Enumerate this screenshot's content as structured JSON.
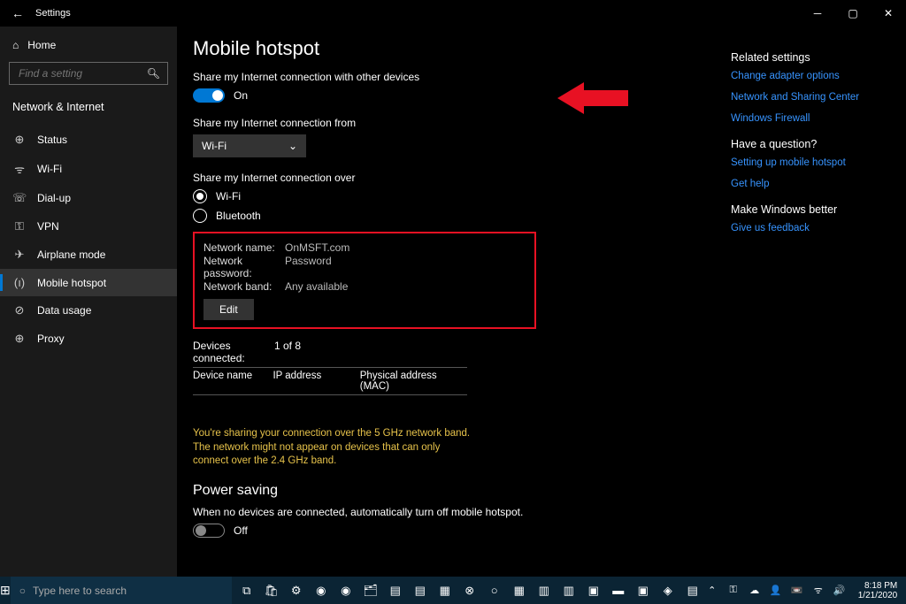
{
  "window": {
    "title": "Settings"
  },
  "sidebar": {
    "home": "Home",
    "search_placeholder": "Find a setting",
    "category": "Network & Internet",
    "items": [
      {
        "icon": "⊕",
        "label": "Status"
      },
      {
        "icon": "ᯤ",
        "label": "Wi-Fi"
      },
      {
        "icon": "☏",
        "label": "Dial-up"
      },
      {
        "icon": "⚿",
        "label": "VPN"
      },
      {
        "icon": "✈",
        "label": "Airplane mode"
      },
      {
        "icon": "(ı)",
        "label": "Mobile hotspot"
      },
      {
        "icon": "⊘",
        "label": "Data usage"
      },
      {
        "icon": "⊕",
        "label": "Proxy"
      }
    ]
  },
  "page": {
    "title": "Mobile hotspot",
    "share_label": "Share my Internet connection with other devices",
    "share_state": "On",
    "from_label": "Share my Internet connection from",
    "from_value": "Wi-Fi",
    "over_label": "Share my Internet connection over",
    "over_options": [
      "Wi-Fi",
      "Bluetooth"
    ],
    "network": {
      "name_label": "Network name:",
      "name_value": "OnMSFT.com",
      "password_label": "Network password:",
      "password_value": "Password",
      "band_label": "Network band:",
      "band_value": "Any available",
      "edit": "Edit"
    },
    "devices": {
      "connected_label": "Devices connected:",
      "connected_value": "1 of 8",
      "col_name": "Device name",
      "col_ip": "IP address",
      "col_mac": "Physical address (MAC)"
    },
    "warning": "You're sharing your connection over the 5 GHz network band. The network might not appear on devices that can only connect over the 2.4 GHz band.",
    "powersave_title": "Power saving",
    "powersave_label": "When no devices are connected, automatically turn off mobile hotspot.",
    "powersave_state": "Off"
  },
  "right": {
    "related_title": "Related settings",
    "links": [
      "Change adapter options",
      "Network and Sharing Center",
      "Windows Firewall"
    ],
    "question_title": "Have a question?",
    "question_links": [
      "Setting up mobile hotspot",
      "Get help"
    ],
    "better_title": "Make Windows better",
    "better_links": [
      "Give us feedback"
    ]
  },
  "taskbar": {
    "search": "Type here to search",
    "time": "8:18 PM",
    "date": "1/21/2020"
  }
}
